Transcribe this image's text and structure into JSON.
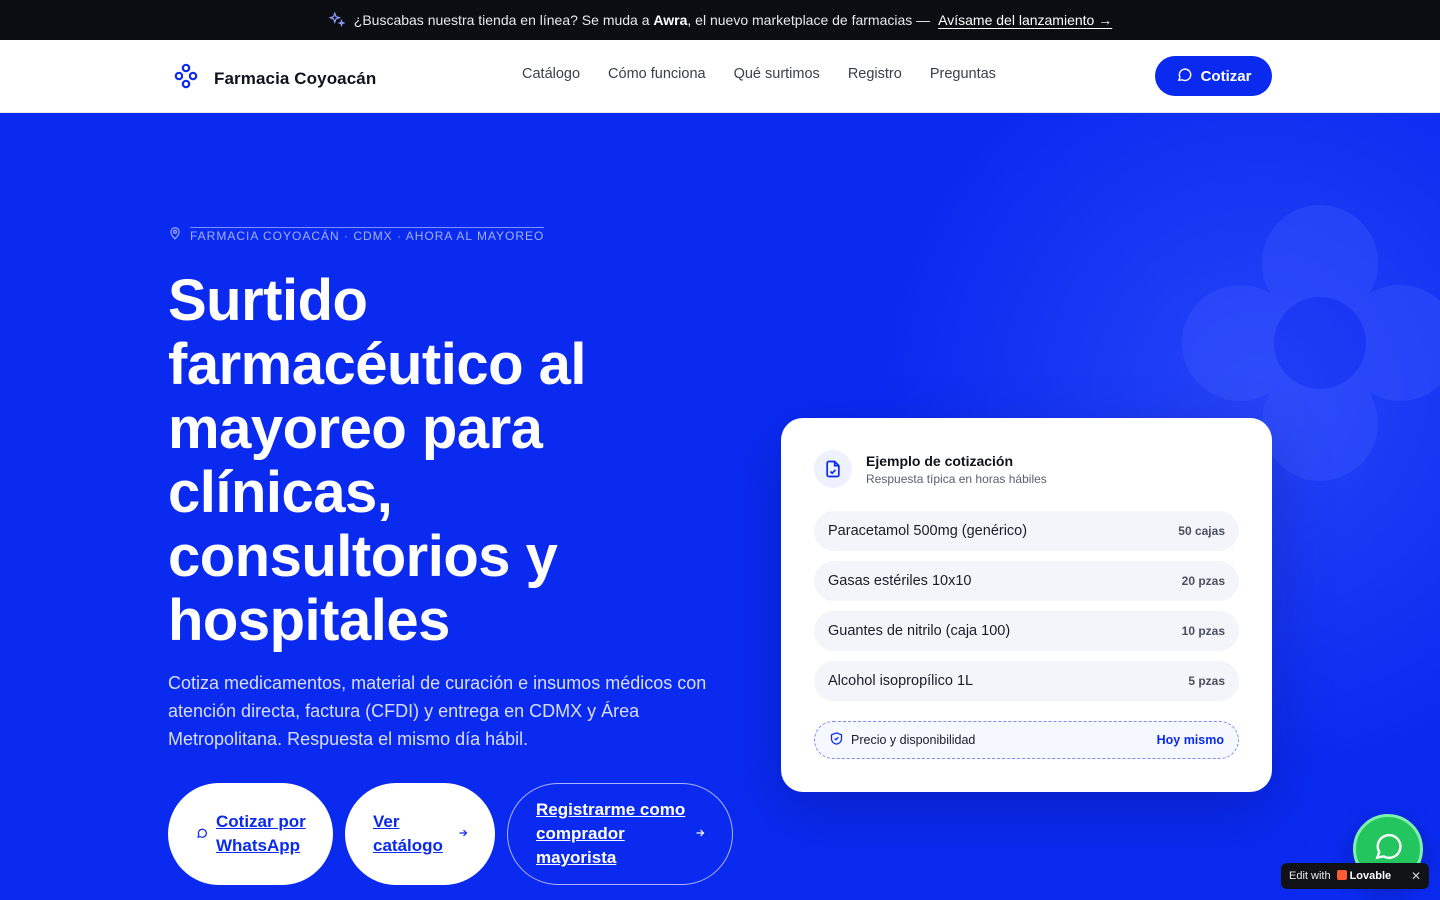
{
  "announcement": {
    "text_before": "¿Buscabas nuestra tienda en línea? Se muda a",
    "brand": "Awra",
    "text_after": ", el nuevo marketplace de farmacias —",
    "link": "Avísame del lanzamiento →",
    "icon": "sparkles-icon"
  },
  "header": {
    "brand_name": "Farmacia Coyoacán",
    "logo_icon": "flower-logo-icon",
    "nav": [
      "Catálogo",
      "Cómo funciona",
      "Qué surtimos",
      "Registro",
      "Preguntas"
    ],
    "cta_label": "Cotizar",
    "cta_icon": "chat-bubble-icon"
  },
  "hero": {
    "eyebrow": "Farmacia Coyoacán · CDMX · Ahora al mayoreo",
    "eyebrow_icon": "map-pin-icon",
    "headline": "Surtido farmacéutico al mayoreo para clínicas, consultorios y hospitales",
    "subheadline": "Cotiza medicamentos, material de curación e insumos médicos con atención directa, factura (CFDI) y entrega en CDMX y Área Metropolitana. Respuesta el mismo día hábil.",
    "buttons": {
      "whatsapp": "Cotizar por WhatsApp",
      "catalog": "Ver catálogo",
      "register": "Registrarme como comprador mayorista"
    }
  },
  "quote_card": {
    "title": "Ejemplo de cotización",
    "subtitle": "Respuesta típica en horas hábiles",
    "items": [
      {
        "name": "Paracetamol 500mg (genérico)",
        "qty": "50 cajas"
      },
      {
        "name": "Gasas estériles 10x10",
        "qty": "20 pzas"
      },
      {
        "name": "Guantes de nitrilo (caja 100)",
        "qty": "10 pzas"
      },
      {
        "name": "Alcohol isopropílico 1L",
        "qty": "5 pzas"
      }
    ],
    "footer_label": "Precio y disponibilidad",
    "footer_value": "Hoy mismo"
  },
  "widgets": {
    "whatsapp_icon": "whatsapp-icon",
    "lovable_prefix": "Edit with",
    "lovable_brand": "Lovable",
    "lovable_close": "✕"
  },
  "colors": {
    "primary": "#0a2af0",
    "announcement_bg": "#0c0d12",
    "whatsapp": "#22c55e"
  }
}
